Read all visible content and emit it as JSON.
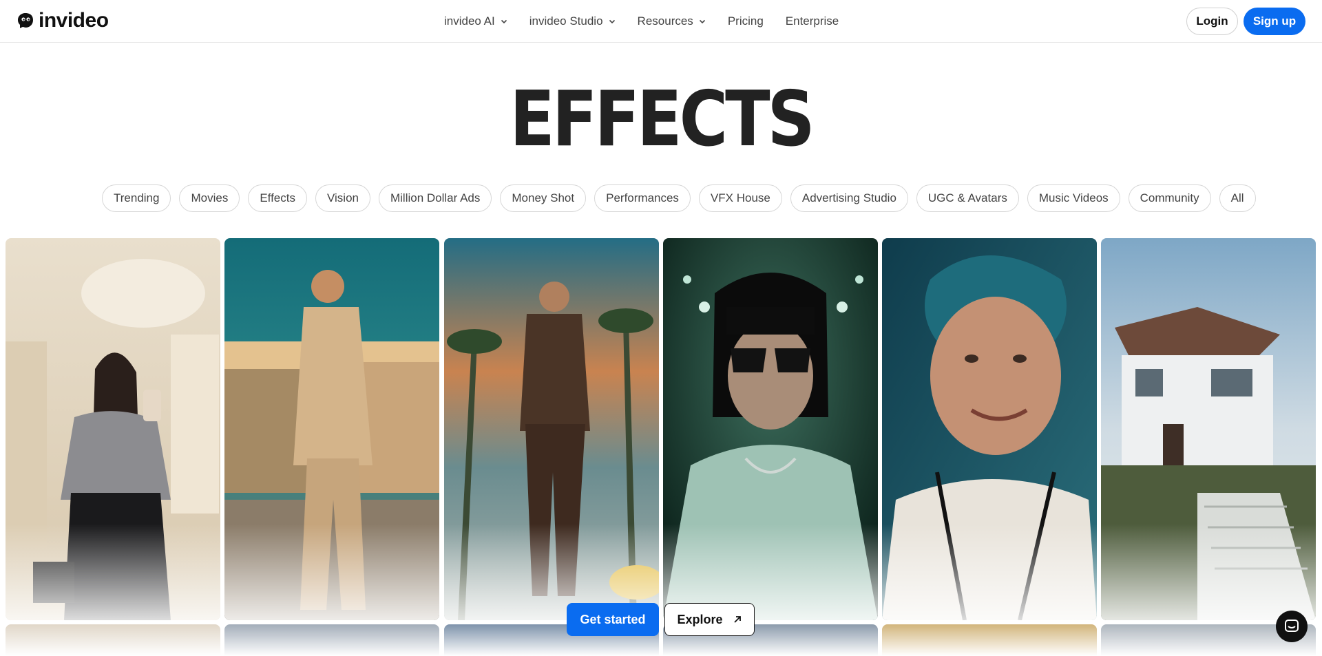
{
  "brand": {
    "name": "invideo",
    "icon": "invideo-logo-icon"
  },
  "nav": {
    "items": [
      {
        "label": "invideo AI",
        "has_dropdown": true
      },
      {
        "label": "invideo Studio",
        "has_dropdown": true
      },
      {
        "label": "Resources",
        "has_dropdown": true
      },
      {
        "label": "Pricing",
        "has_dropdown": false
      },
      {
        "label": "Enterprise",
        "has_dropdown": false
      }
    ],
    "login_label": "Login",
    "signup_label": "Sign up"
  },
  "page_title": "EFFECTS",
  "categories": [
    "Trending",
    "Movies",
    "Effects",
    "Vision",
    "Million Dollar Ads",
    "Money Shot",
    "Performances",
    "VFX House",
    "Advertising Studio",
    "UGC & Avatars",
    "Music Videos",
    "Community",
    "All"
  ],
  "cards": [
    {
      "subject": "woman-mirror-selfie-silver-top",
      "colors": [
        "#efe5d4",
        "#c9b99c",
        "#8a8a8e",
        "#1d1d1f"
      ]
    },
    {
      "subject": "man-beige-suit-gas-station",
      "colors": [
        "#1f7a84",
        "#c9a26a",
        "#d4b48a",
        "#6d6256"
      ]
    },
    {
      "subject": "man-brown-suit-palm-street",
      "colors": [
        "#2b6f86",
        "#d27d3d",
        "#4a3426",
        "#8aa5a8"
      ]
    },
    {
      "subject": "woman-bob-sunglasses-tunnel",
      "colors": [
        "#0f2a22",
        "#1f4d3e",
        "#8fb5a7",
        "#0c0c0c"
      ]
    },
    {
      "subject": "man-blue-hair-smiling",
      "colors": [
        "#174b5a",
        "#2c7283",
        "#c08d70",
        "#e8e4dc"
      ]
    },
    {
      "subject": "white-mansion-stairs",
      "colors": [
        "#8fb2cc",
        "#d8e2e8",
        "#5b6a47",
        "#f1f3f4"
      ]
    }
  ],
  "cta": {
    "primary_label": "Get started",
    "secondary_label": "Explore"
  },
  "accent_color": "#0a6cf0"
}
